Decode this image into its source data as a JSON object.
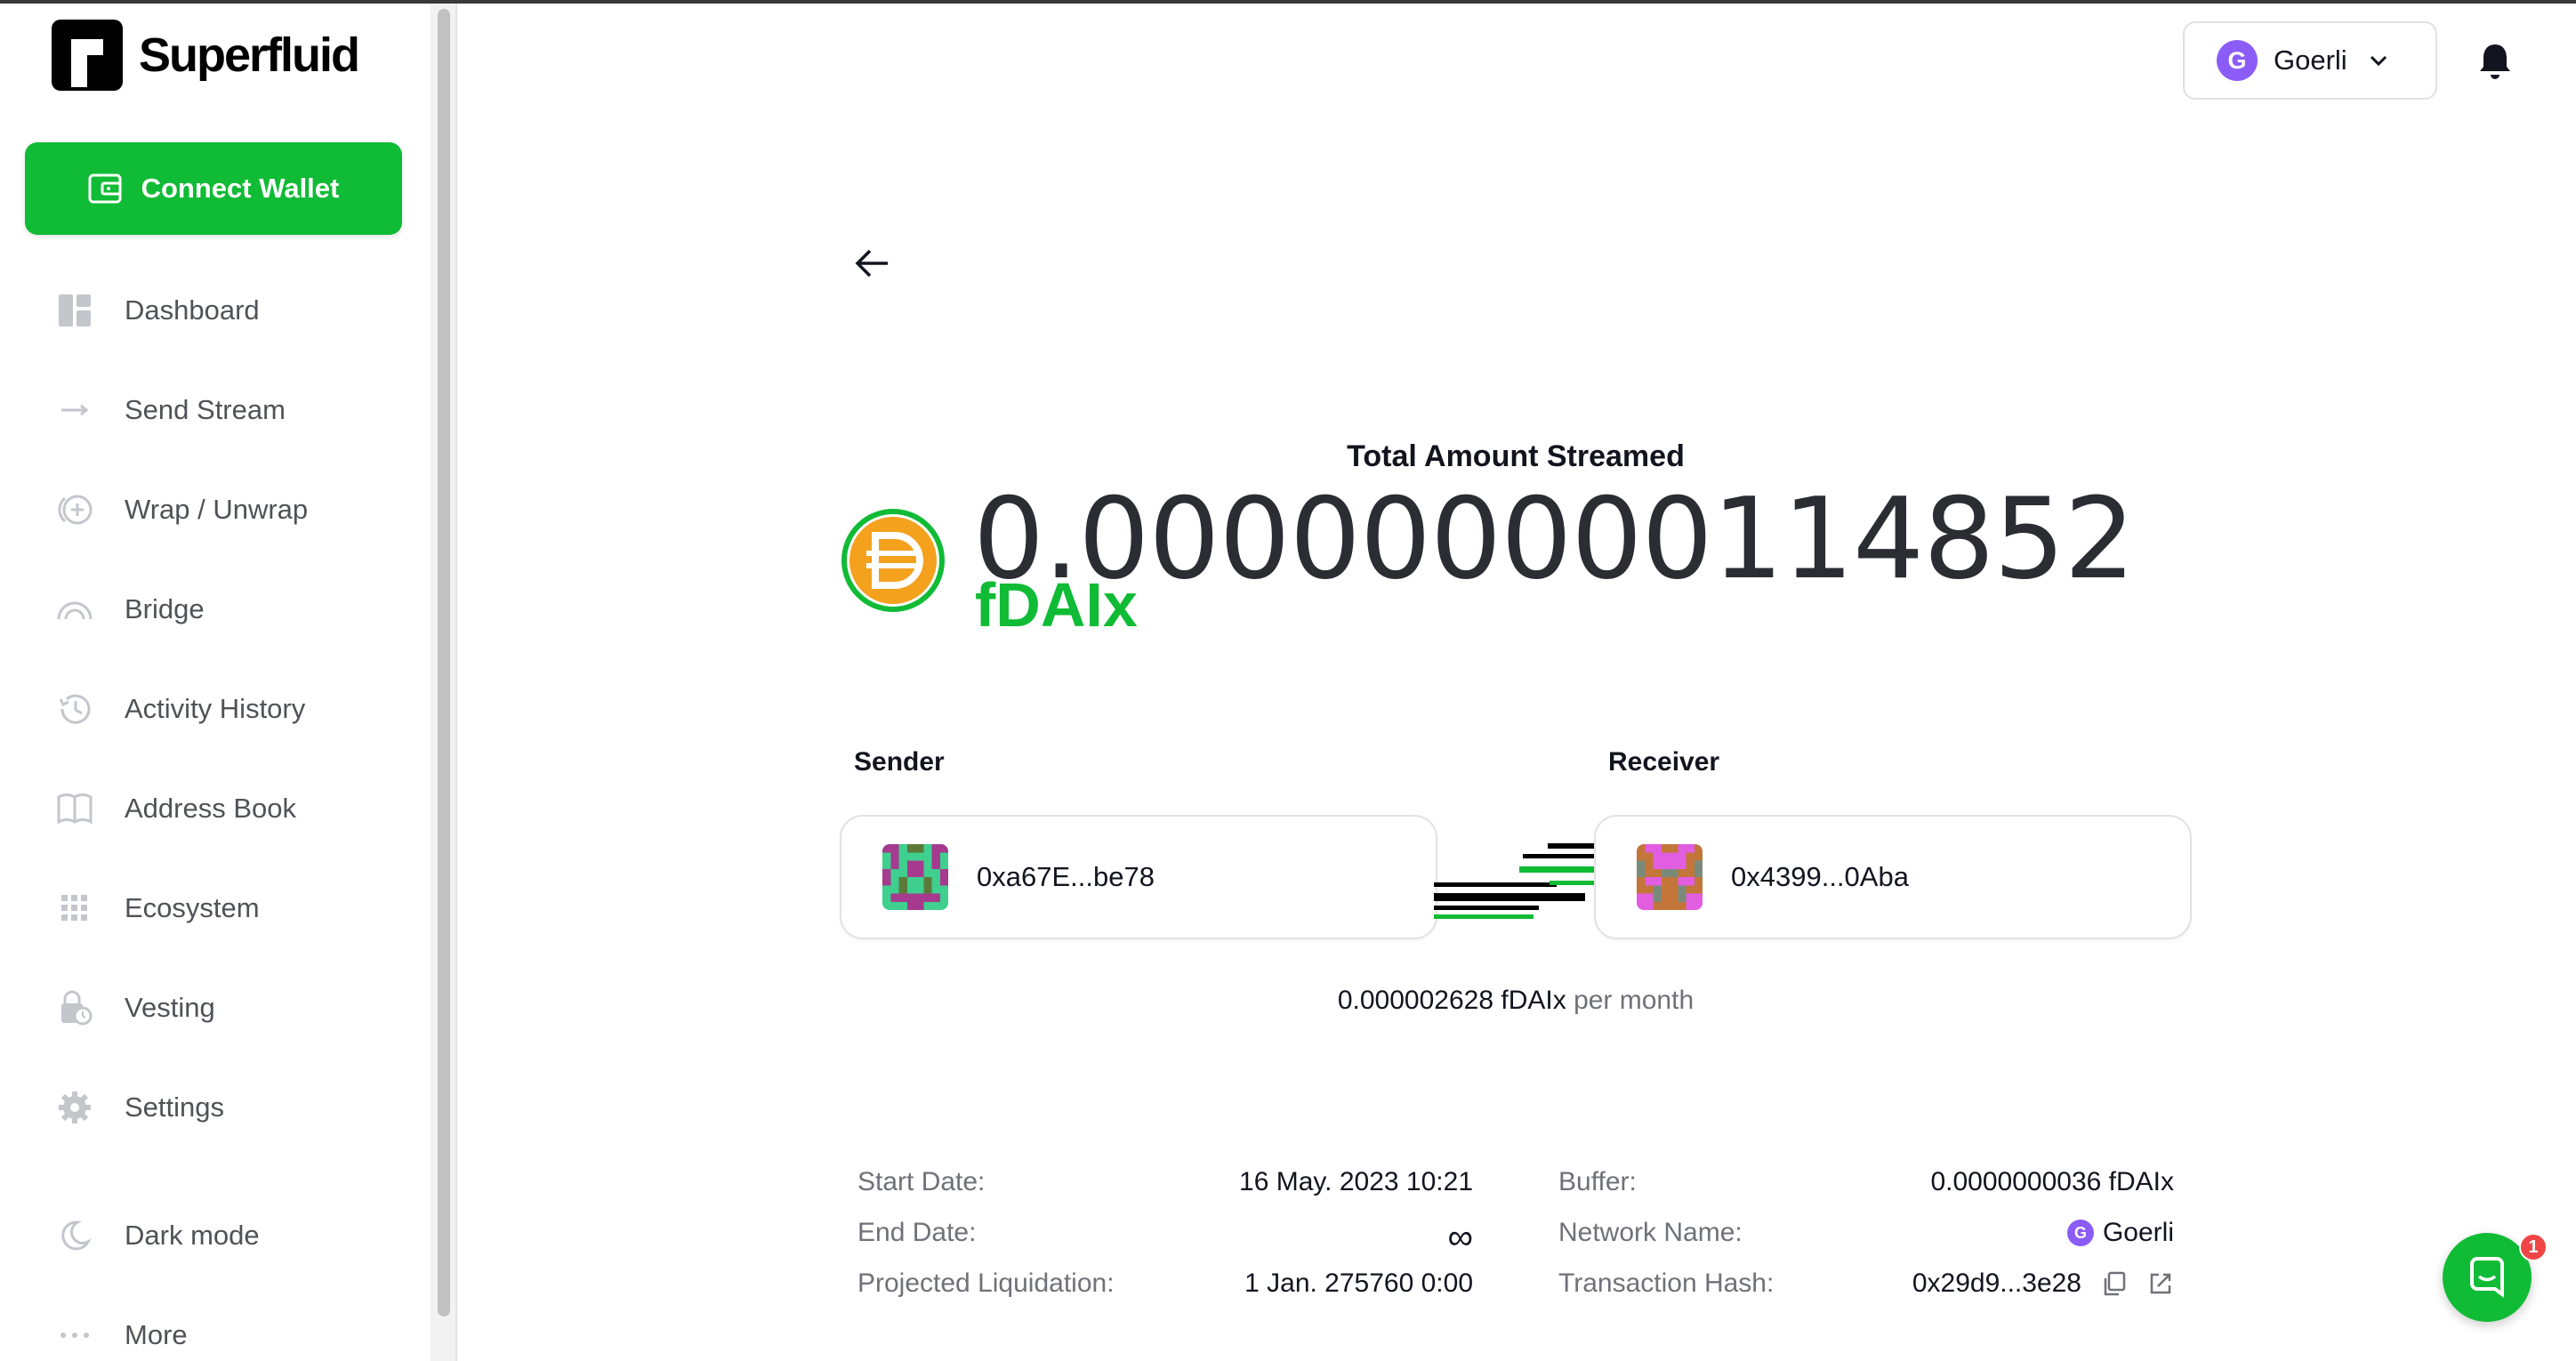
{
  "app": {
    "brand": "Superfluid"
  },
  "sidebar": {
    "connect_label": "Connect Wallet",
    "items": [
      {
        "label": "Dashboard",
        "icon": "dashboard-icon"
      },
      {
        "label": "Send Stream",
        "icon": "arrow-right-icon"
      },
      {
        "label": "Wrap / Unwrap",
        "icon": "wrap-icon"
      },
      {
        "label": "Bridge",
        "icon": "bridge-icon"
      },
      {
        "label": "Activity History",
        "icon": "history-icon"
      },
      {
        "label": "Address Book",
        "icon": "book-icon"
      },
      {
        "label": "Ecosystem",
        "icon": "grid-icon"
      },
      {
        "label": "Vesting",
        "icon": "lock-clock-icon"
      },
      {
        "label": "Settings",
        "icon": "gear-icon"
      },
      {
        "label": "Dark mode",
        "icon": "moon-icon"
      },
      {
        "label": "More",
        "icon": "more-icon"
      }
    ]
  },
  "header": {
    "network": "Goerli",
    "network_badge": "G"
  },
  "stream": {
    "total_label": "Total Amount Streamed",
    "amount": "0.000000000114852",
    "token": "fDAIx",
    "sender_label": "Sender",
    "receiver_label": "Receiver",
    "sender": "0xa67E...be78",
    "receiver": "0x4399...0Aba",
    "rate_value": "0.000002628 fDAIx",
    "rate_unit": "per month"
  },
  "details": {
    "left": [
      {
        "key": "Start Date:",
        "value": "16 May. 2023 10:21"
      },
      {
        "key": "End Date:",
        "value": "∞"
      },
      {
        "key": "Projected Liquidation:",
        "value": "1 Jan. 275760 0:00"
      }
    ],
    "right": [
      {
        "key": "Buffer:",
        "value": "0.0000000036 fDAIx"
      },
      {
        "key": "Network Name:",
        "value": "Goerli"
      },
      {
        "key": "Transaction Hash:",
        "value": "0x29d9...3e28"
      }
    ]
  },
  "chat": {
    "badge": "1"
  },
  "colors": {
    "accent": "#10bb35",
    "network": "#8b5cf6",
    "token": "#f4a11d"
  }
}
